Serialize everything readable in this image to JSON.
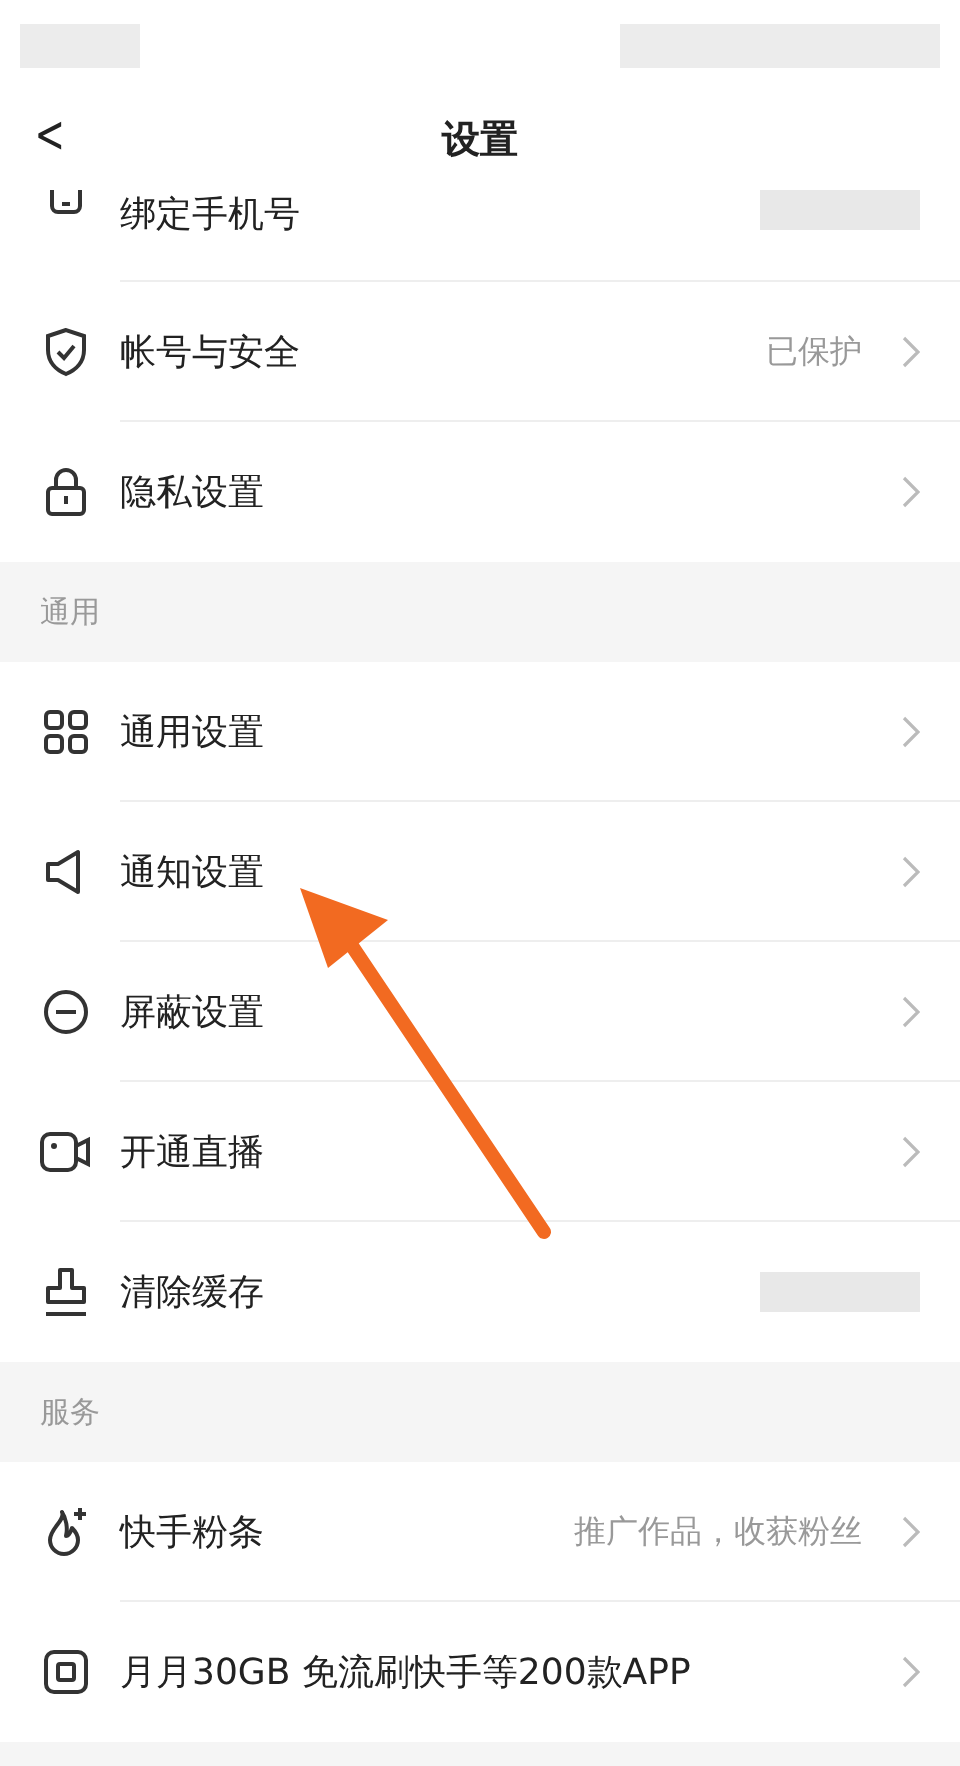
{
  "header": {
    "back": "<",
    "title": "设置"
  },
  "groups": [
    {
      "rows": [
        {
          "label": "绑定手机号",
          "kind": "masked"
        },
        {
          "label": "帐号与安全",
          "value": "已保护",
          "kind": "chevron"
        },
        {
          "label": "隐私设置",
          "kind": "chevron"
        }
      ]
    },
    {
      "title": "通用",
      "rows": [
        {
          "label": "通用设置",
          "kind": "chevron"
        },
        {
          "label": "通知设置",
          "kind": "chevron"
        },
        {
          "label": "屏蔽设置",
          "kind": "chevron"
        },
        {
          "label": "开通直播",
          "kind": "chevron"
        },
        {
          "label": "清除缓存",
          "kind": "masked"
        }
      ]
    },
    {
      "title": "服务",
      "rows": [
        {
          "label": "快手粉条",
          "value": "推广作品，收获粉丝",
          "kind": "chevron"
        },
        {
          "label": "月月30GB 免流刷快手等200款APP",
          "kind": "chevron"
        }
      ]
    }
  ]
}
